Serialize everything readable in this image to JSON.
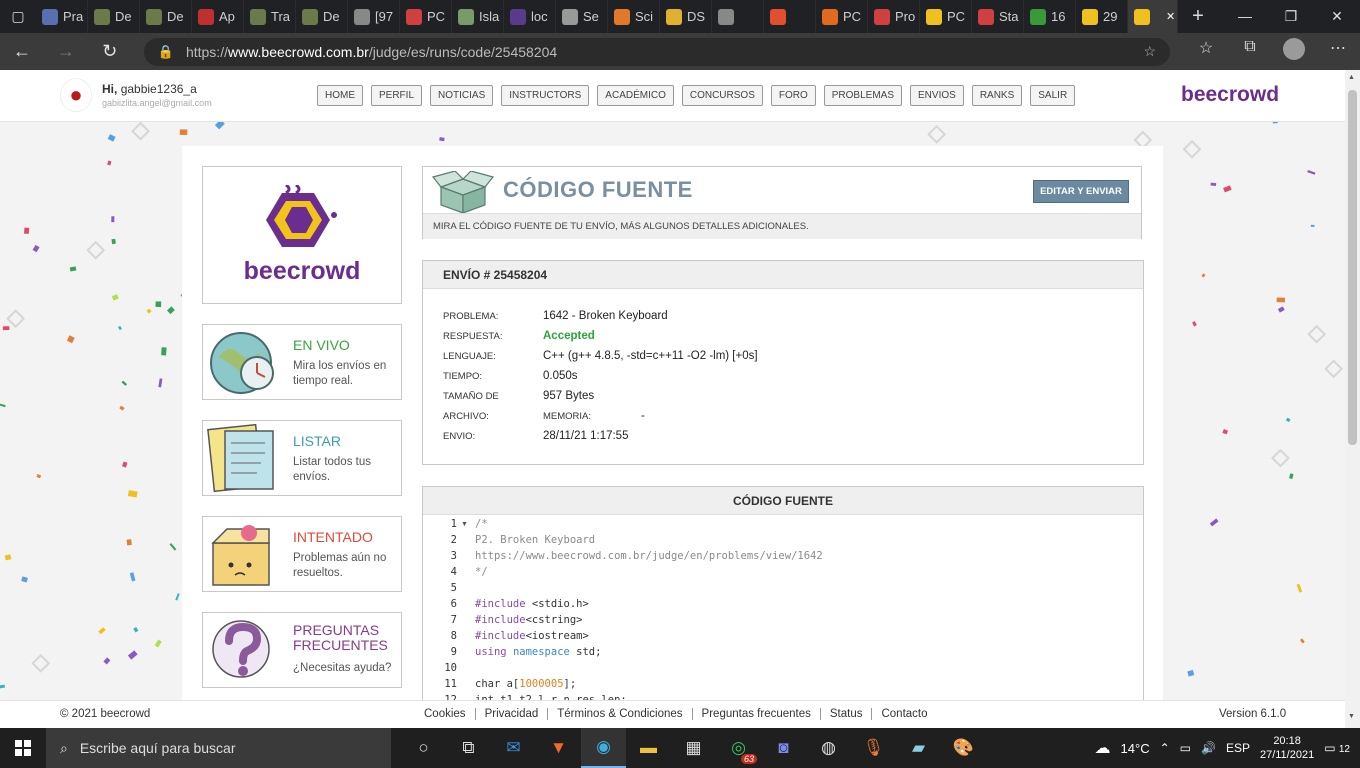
{
  "browser": {
    "tabs": [
      "Pra",
      "De",
      "De",
      "Ap",
      "Tra",
      "De",
      "[97",
      "PC",
      "Isla",
      "loc",
      "Se",
      "Sci",
      "DS",
      "",
      "",
      "PC",
      "Pro",
      "PC",
      "Sta",
      "16",
      "29",
      ""
    ],
    "url_prefix": "https://",
    "url_domain": "www.beecrowd.com.br",
    "url_path": "/judge/es/runs/code/25458204"
  },
  "header": {
    "greeting_prefix": "Hi,",
    "username": "gabbie1236_a",
    "email": "gabiizlita.angel@gmail.com",
    "nav": [
      "HOME",
      "PERFIL",
      "NOTICIAS",
      "INSTRUCTORS",
      "ACADÉMICO",
      "CONCURSOS",
      "FORO",
      "PROBLEMAS",
      "ENVIOS",
      "RANKS",
      "SALIR"
    ],
    "brand": "beecrowd"
  },
  "sidebar": {
    "logo_text": "beecrowd",
    "cards": [
      {
        "title": "EN VIVO",
        "desc": "Mira los envíos en tiempo real.",
        "color": "#3aa53a"
      },
      {
        "title": "LISTAR",
        "desc": "Listar todos tus envíos.",
        "color": "#3a9fb0"
      },
      {
        "title": "INTENTADO",
        "desc": "Problemas aún no resueltos.",
        "color": "#e04a3a"
      },
      {
        "title": "PREGUNTAS FRECUENTES",
        "desc": "¿Necesitas ayuda?",
        "color": "#8a3a8a"
      }
    ]
  },
  "source_box": {
    "title": "CÓDIGO FUENTE",
    "edit_button": "EDITAR Y ENVIAR",
    "subtitle": "MIRA EL CÓDIGO FUENTE DE TU ENVÍO, MÁS ALGUNOS DETALLES ADICIONALES."
  },
  "submission": {
    "heading": "ENVÍO # 25458204",
    "rows": [
      {
        "label": "PROBLEMA:",
        "value": "1642 - Broken Keyboard"
      },
      {
        "label": "RESPUESTA:",
        "value": "Accepted"
      },
      {
        "label": "LENGUAJE:",
        "value": "C++ (g++ 4.8.5, -std=c++11 -O2 -lm) [+0s]"
      },
      {
        "label": "TIEMPO:",
        "value": "0.050s"
      },
      {
        "label": "TAMAÑO DE",
        "value": "957 Bytes"
      },
      {
        "label": "ARCHIVO:",
        "value": "MEMORIA:",
        "extra": "-"
      },
      {
        "label": "ENVIO:",
        "value": "28/11/21 1:17:55"
      }
    ]
  },
  "code": {
    "heading": "CÓDIGO FUENTE",
    "lines": [
      "/*",
      "P2. Broken Keyboard",
      "https://www.beecrowd.com.br/judge/en/problems/view/1642",
      "*/",
      "",
      "#include <stdio.h>",
      "#include<cstring>",
      "#include<iostream>",
      "using namespace std;",
      "",
      "char a[1000005];",
      "int t1,t2,l,r,n,res,len;"
    ]
  },
  "footer": {
    "copyright": "© 2021 beecrowd",
    "links": [
      "Cookies",
      "Privacidad",
      "Términos & Condiciones",
      "Preguntas frecuentes",
      "Status",
      "Contacto"
    ],
    "version": "Version 6.1.0"
  },
  "taskbar": {
    "search_placeholder": "Escribe aquí para buscar",
    "whatsapp_badge": "63",
    "temperature": "14°C",
    "language": "ESP",
    "time": "20:18",
    "date": "27/11/2021",
    "notifications": "12"
  }
}
